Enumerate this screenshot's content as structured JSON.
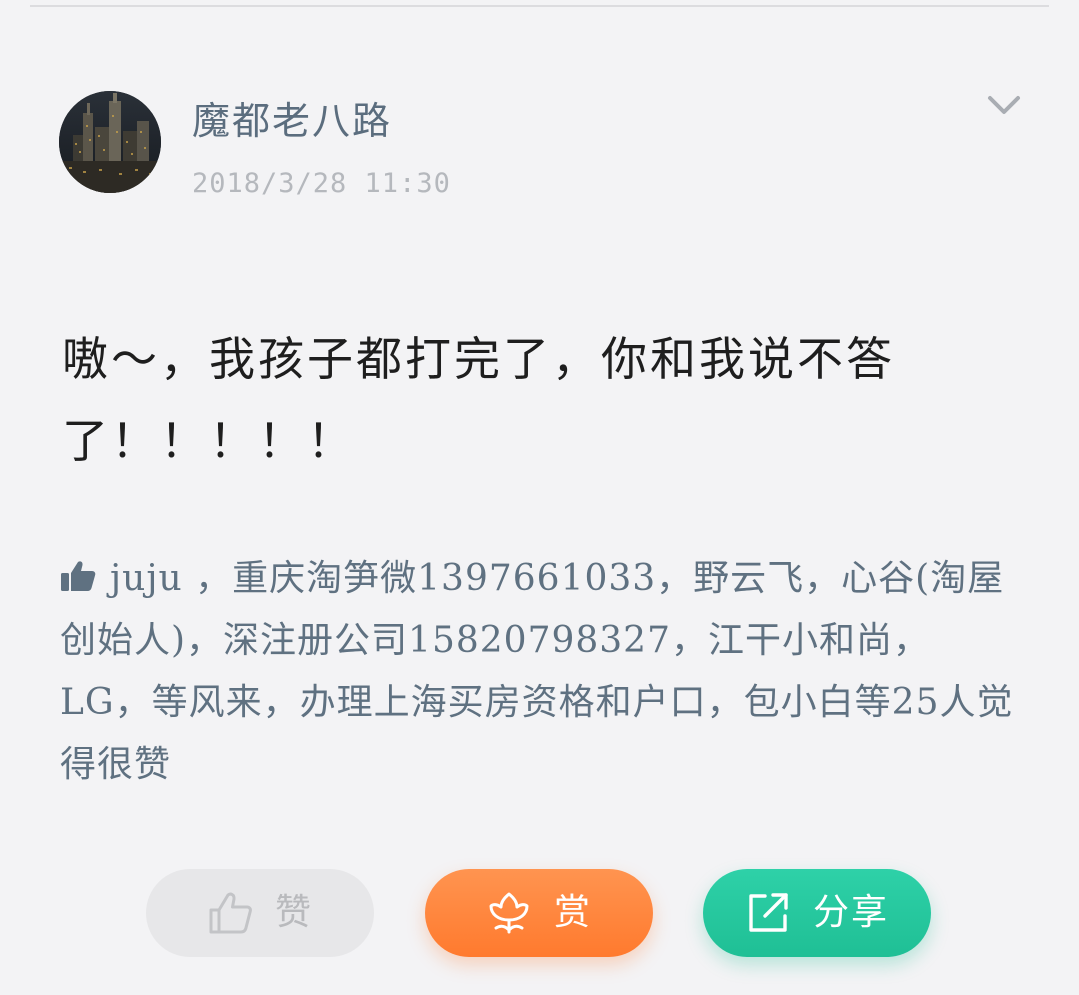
{
  "post": {
    "author": "魔都老八路",
    "timestamp": "2018/3/28 11:30",
    "content": "嗷～，我孩子都打完了，你和我说不答了！！！！！",
    "likes_text": "juju ，重庆淘笋微1397661033，野云飞，心谷(淘屋创始人)，深注册公司15820798327，江干小和尚，LG，等风来，办理上海买房资格和户口，包小白等25人觉得很赞"
  },
  "actions": {
    "like_label": "赞",
    "reward_label": "赏",
    "share_label": "分享"
  },
  "icons": {
    "more": "chevron-down-icon",
    "like": "thumbs-up-icon",
    "reward": "flower-icon",
    "share": "external-link-icon"
  },
  "colors": {
    "background": "#f3f3f5",
    "name_color": "#5b6d7e",
    "time_color": "#b5b8bd",
    "likes_color": "#5f7181",
    "like_button": "#e7e7e9",
    "reward_button": "#ff8a3d",
    "share_button": "#24c89e"
  }
}
